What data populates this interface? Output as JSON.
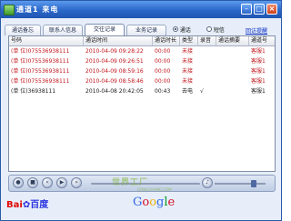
{
  "window": {
    "title": "通道1 来电"
  },
  "tabs": [
    "通话备忘",
    "联系人信息",
    "交往记录",
    "业务记录"
  ],
  "filter": {
    "options": [
      "通话",
      "短信"
    ],
    "selected": "通话",
    "link": "回访提醒"
  },
  "table": {
    "columns": [
      "号码",
      "通话时间",
      "通话时长",
      "类型",
      "录音",
      "通话摘要",
      "通道号"
    ],
    "rows": [
      {
        "number": "(单 位)075536938111",
        "time": "2010-04-09 09:28:22",
        "duration": "00:00",
        "type": "未接",
        "recording": "",
        "summary": "",
        "channel": "客服1",
        "missed": true
      },
      {
        "number": "(单 位)075536938111",
        "time": "2010-04-09 09:26:51",
        "duration": "00:00",
        "type": "未接",
        "recording": "",
        "summary": "",
        "channel": "客服1",
        "missed": true
      },
      {
        "number": "(单 位)075536938111",
        "time": "2010-04-09 08:59:16",
        "duration": "00:00",
        "type": "未接",
        "recording": "",
        "summary": "",
        "channel": "客服1",
        "missed": true
      },
      {
        "number": "(单 位)075536938111",
        "time": "2010-04-09 08:58:46",
        "duration": "00:00",
        "type": "未接",
        "recording": "",
        "summary": "",
        "channel": "客服1",
        "missed": true
      },
      {
        "number": "(单 位)36938111",
        "time": "2010-04-08 20:42:05",
        "duration": "00:43",
        "type": "去电",
        "recording": "√",
        "summary": "",
        "channel": "客服1",
        "missed": false
      }
    ]
  },
  "branding": {
    "baidu_latin": "Bai",
    "baidu_cn": "百度",
    "google": "Google",
    "watermark": "世界工厂",
    "watermark_sub": "GONGCHANG.COM"
  },
  "colors": {
    "missed_text": "#c0151b",
    "title_bar": "#2a67c8",
    "link": "#0b2fc2"
  }
}
